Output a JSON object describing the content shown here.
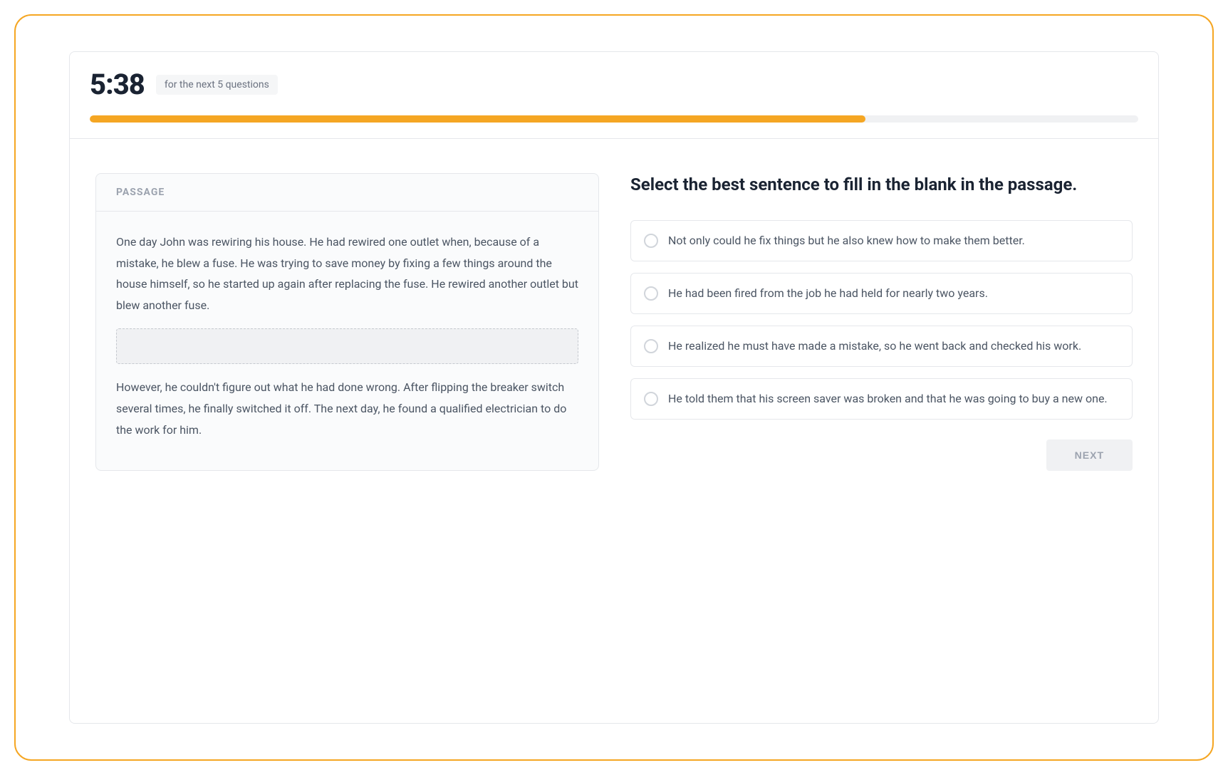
{
  "timer": {
    "value": "5:38",
    "label": "for the next 5 questions"
  },
  "progress": {
    "percent": 74
  },
  "passage": {
    "header": "PASSAGE",
    "paragraph1": "One day John was rewiring his house. He had rewired one outlet when, because of a mistake, he blew a fuse. He was trying to save money by fixing a few things around the house himself, so he started up again after replacing the fuse. He rewired another outlet but blew another fuse.",
    "paragraph2": "However, he couldn't figure out what he had done wrong. After flipping the breaker switch several times, he finally switched it off. The next day, he found a qualified electrician to do the work for him."
  },
  "question": {
    "title": "Select the best sentence to fill in the blank in the passage.",
    "options": [
      "Not only could he fix things but he also knew how to make them better.",
      "He had been fired from the job he had held for nearly two years.",
      "He realized he must have made a mistake, so he went back and checked his work.",
      "He told them that his screen saver was broken and that he was going to buy a new one."
    ]
  },
  "actions": {
    "next": "NEXT"
  }
}
